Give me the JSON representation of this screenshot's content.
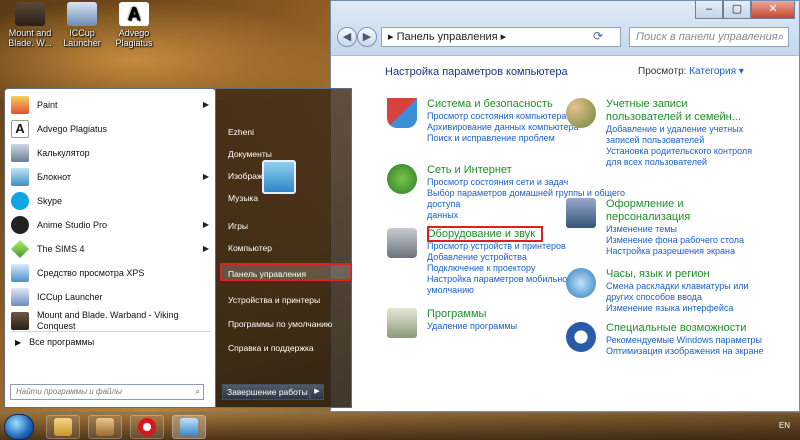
{
  "desktop": {
    "icons": [
      {
        "label": "Mount and Blade. W...",
        "name": "mount-blade-desktop-icon"
      },
      {
        "label": "ICCup Launcher",
        "name": "iccup-desktop-icon"
      },
      {
        "label": "Advego Plagiatus",
        "name": "advego-desktop-icon"
      }
    ]
  },
  "control_panel": {
    "address": "▸ Панель управления ▸",
    "search_placeholder": "Поиск в панели управления",
    "title": "Настройка параметров компьютера",
    "view_label": "Просмотр:",
    "view_value": "Категория ▾",
    "categories": [
      {
        "title": "Система и безопасность",
        "links": [
          "Просмотр состояния компьютера",
          "Архивирование данных компьютера",
          "Поиск и исправление проблем"
        ]
      },
      {
        "title": "Сеть и Интернет",
        "links": [
          "Просмотр состояния сети и задач",
          "Выбор параметров домашней группы и общего доступа",
          "данных"
        ]
      },
      {
        "title": "Оборудование и звук",
        "links": [
          "Просмотр устройств и принтеров",
          "Добавление устройства",
          "Подключение к проектору",
          "Настройка параметров мобильности по умолчанию"
        ]
      },
      {
        "title": "Программы",
        "links": [
          "Удаление программы"
        ]
      },
      {
        "title": "Учетные записи пользователей и семейн...",
        "links": [
          "Добавление и удаление учетных записей пользователей",
          "Установка родительского контроля для всех пользователей"
        ]
      },
      {
        "title": "Оформление и персонализация",
        "links": [
          "Изменение темы",
          "Изменение фона рабочего стола",
          "Настройка разрешения экрана"
        ]
      },
      {
        "title": "Часы, язык и регион",
        "links": [
          "Смена раскладки клавиатуры или других способов ввода",
          "Изменение языка интерфейса"
        ]
      },
      {
        "title": "Специальные возможности",
        "links": [
          "Рекомендуемые Windows параметры",
          "Оптимизация изображения на экране"
        ]
      }
    ]
  },
  "start_menu": {
    "programs": [
      {
        "label": "Paint",
        "arrow": "▶"
      },
      {
        "label": "Advego Plagiatus",
        "arrow": ""
      },
      {
        "label": "Калькулятор",
        "arrow": ""
      },
      {
        "label": "Блокнот",
        "arrow": "▶"
      },
      {
        "label": "Skype",
        "arrow": ""
      },
      {
        "label": "Anime Studio Pro",
        "arrow": "▶"
      },
      {
        "label": "The SIMS 4",
        "arrow": "▶"
      },
      {
        "label": "Средство просмотра XPS",
        "arrow": ""
      },
      {
        "label": "ICCup Launcher",
        "arrow": ""
      },
      {
        "label": "Mount and Blade. Warband - Viking Conquest",
        "arrow": ""
      }
    ],
    "all_programs": "Все программы",
    "search_placeholder": "Найти программы и файлы",
    "right_items": [
      "Ezheni",
      "Документы",
      "Изображения",
      "Музыка",
      "Игры",
      "Компьютер",
      "Панель управления",
      "Устройства и принтеры",
      "Программы по умолчанию",
      "Справка и поддержка"
    ],
    "shutdown": "Завершение работы"
  },
  "taskbar": {
    "lang": "EN"
  },
  "watermark": "club Sovet"
}
